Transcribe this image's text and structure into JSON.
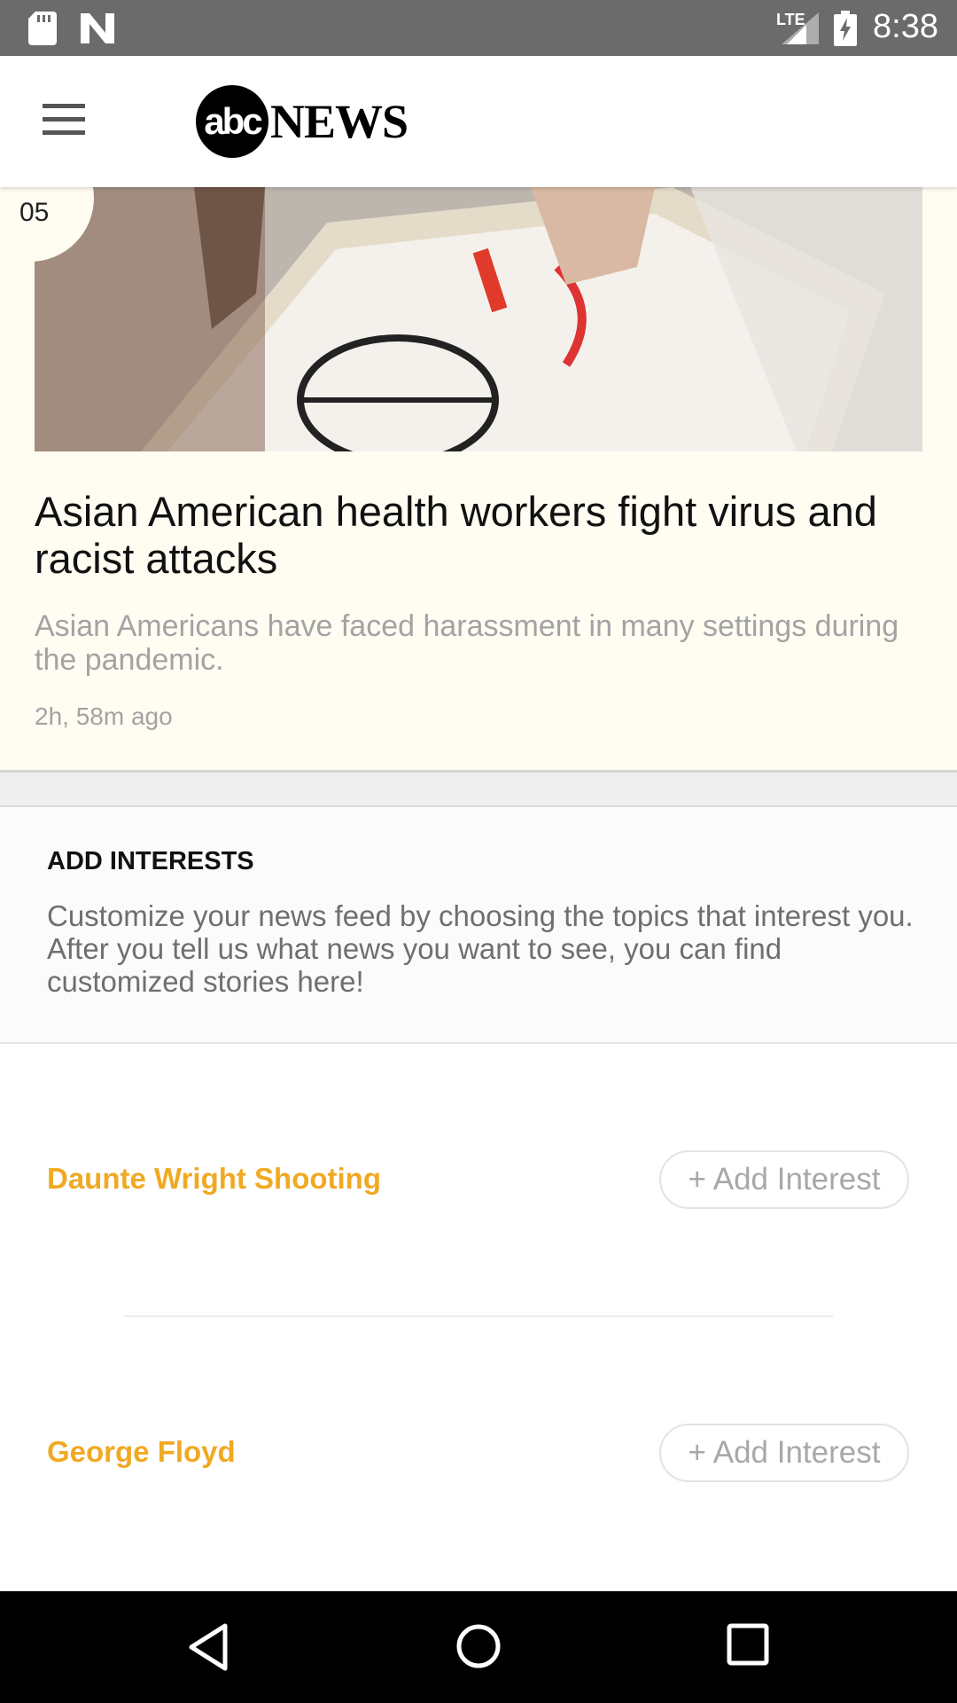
{
  "status_bar": {
    "lte": "LTE",
    "time": "8:38",
    "icons": [
      "sd-card-icon",
      "n-notification-icon",
      "signal-icon",
      "battery-charging-icon"
    ]
  },
  "app_bar": {
    "menu_icon": "hamburger-menu-icon",
    "logo_text": "abcNEWS",
    "logo_circle": "abc",
    "logo_word": "NEWS"
  },
  "story": {
    "number": "05",
    "title": "Asian American health workers fight virus and racist attacks",
    "summary": "Asian Americans have faced harassment in many settings during the pandemic.",
    "time": "2h, 58m ago"
  },
  "interests": {
    "heading": "ADD INTERESTS",
    "description": "Customize your news feed by choosing the topics that interest you. After you tell us what news you want to see, you can find customized stories here!",
    "items": [
      {
        "name": "Daunte Wright Shooting",
        "button": "+ Add Interest"
      },
      {
        "name": "George Floyd",
        "button": "+ Add Interest"
      }
    ]
  },
  "nav_bar": {
    "icons": [
      "back-icon",
      "home-icon",
      "recents-icon"
    ]
  },
  "colors": {
    "accent": "#f0a922",
    "status_bar": "#6b6b6b",
    "card_background": "#fffcf2"
  }
}
